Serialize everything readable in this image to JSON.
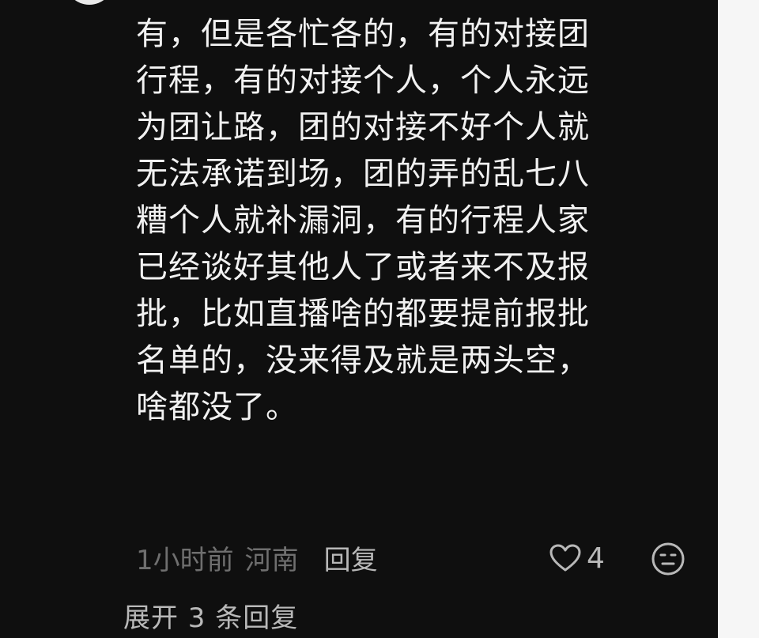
{
  "comment": {
    "lines": [
      "有，但是各忙各的，有的对接团",
      "行程，有的对接个人，个人永远",
      "为团让路，团的对接不好个人就",
      "无法承诺到场，团的弄的乱七八",
      "糟个人就补漏洞，有的行程人家",
      "已经谈好其他人了或者来不及报",
      "批，比如直播啥的都要提前报批",
      "名单的，没来得及就是两头空，",
      "啥都没了。"
    ],
    "time": "1小时前",
    "location": "河南",
    "reply_label": "回复",
    "like_count": "4",
    "like_icon": "heart-outline-icon",
    "dislike_icon": "dislike-face-icon"
  },
  "replies": {
    "expand_label": "展开 3 条回复"
  },
  "colors": {
    "background": "#0f0f0f",
    "text_primary": "#f1f1f1",
    "text_secondary": "#6f6f6f",
    "text_action": "#b8b8b8"
  }
}
